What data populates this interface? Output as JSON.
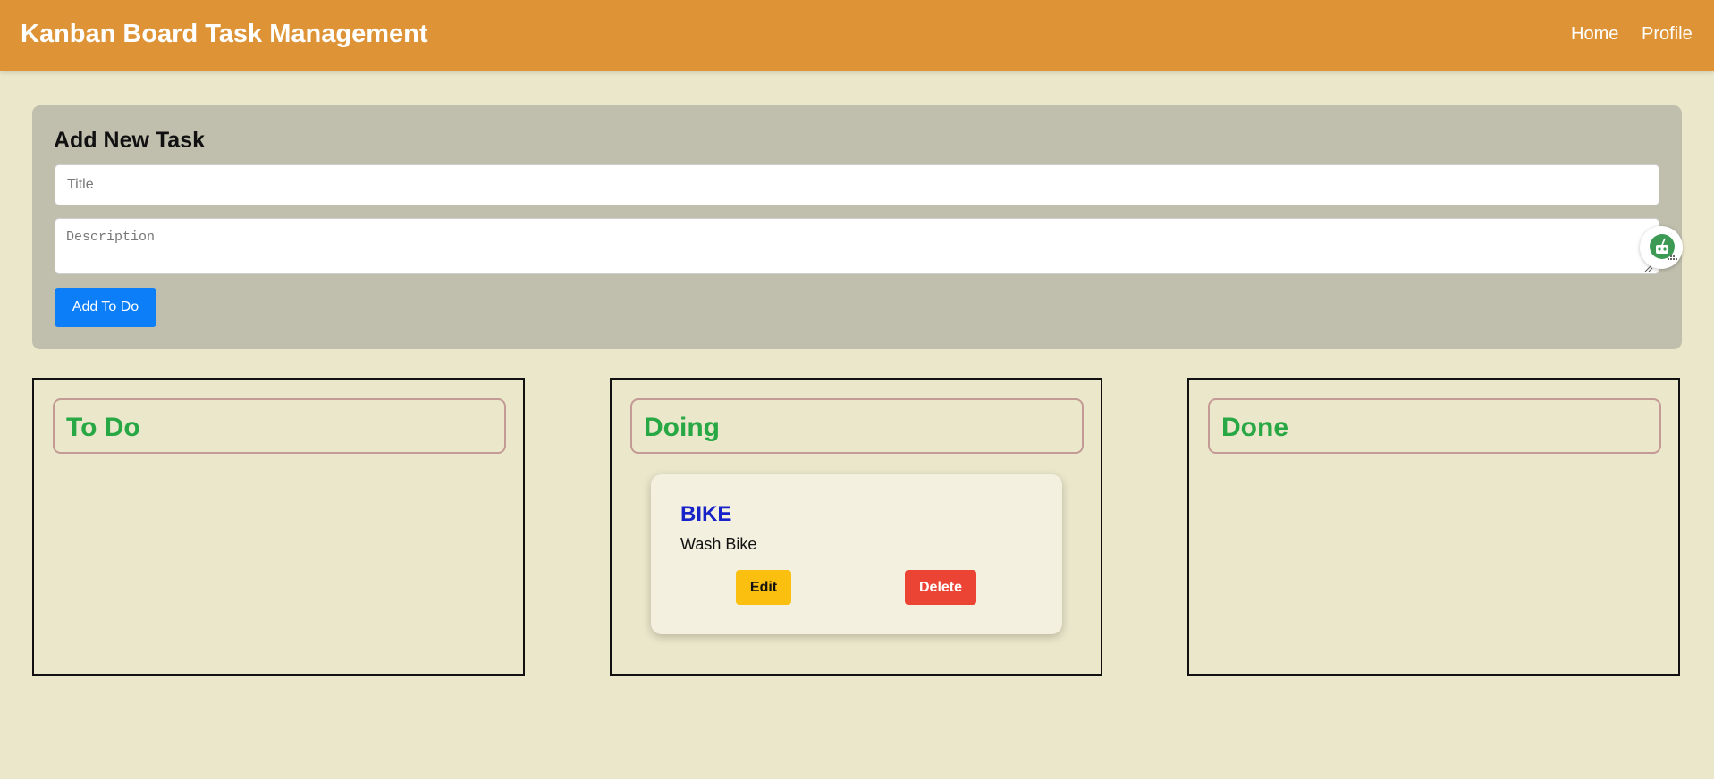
{
  "header": {
    "brand": "Kanban Board Task Management",
    "nav": [
      {
        "label": "Home"
      },
      {
        "label": "Profile"
      }
    ]
  },
  "form": {
    "heading": "Add New Task",
    "title_placeholder": "Title",
    "title_value": "",
    "description_placeholder": "Description",
    "description_value": "",
    "add_button_label": "Add To Do",
    "assistant_icon": "robot-assistant-icon"
  },
  "columns": [
    {
      "title": "To Do",
      "tasks": []
    },
    {
      "title": "Doing",
      "tasks": [
        {
          "title": "BIKE",
          "description": "Wash Bike",
          "edit_label": "Edit",
          "delete_label": "Delete"
        }
      ]
    },
    {
      "title": "Done",
      "tasks": []
    }
  ],
  "colors": {
    "navbar": "#dd9336",
    "page_background": "#ebe7cb",
    "form_panel": "#c0bfad",
    "primary_button": "#0b7ef8",
    "column_title": "#28a745",
    "task_title": "#1722c8",
    "edit_button": "#fbbf0f",
    "delete_button": "#ec4434"
  }
}
